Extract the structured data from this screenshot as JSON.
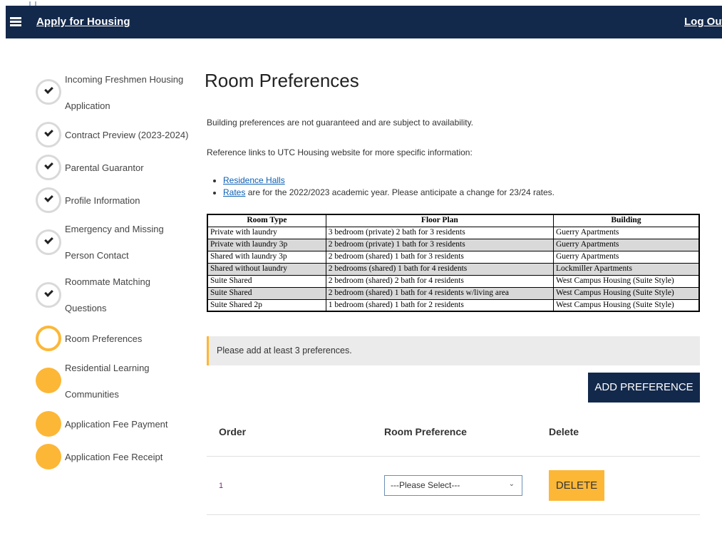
{
  "header": {
    "title": "Apply for Housing",
    "logout": "Log Out"
  },
  "steps": [
    {
      "label_lines": [
        "Incoming Freshmen Housing",
        "Application"
      ],
      "status": "done"
    },
    {
      "label_lines": [
        "Contract Preview (2023-2024)"
      ],
      "status": "done"
    },
    {
      "label_lines": [
        "Parental Guarantor"
      ],
      "status": "done"
    },
    {
      "label_lines": [
        "Profile Information"
      ],
      "status": "done"
    },
    {
      "label_lines": [
        "Emergency and Missing",
        "Person Contact"
      ],
      "status": "done"
    },
    {
      "label_lines": [
        "Roommate Matching",
        "Questions"
      ],
      "status": "done"
    },
    {
      "label_lines": [
        "Room Preferences"
      ],
      "status": "current"
    },
    {
      "label_lines": [
        "Residential Learning",
        "Communities"
      ],
      "status": "todo"
    },
    {
      "label_lines": [
        "Application Fee Payment"
      ],
      "status": "todo"
    },
    {
      "label_lines": [
        "Application Fee Receipt"
      ],
      "status": "todo"
    }
  ],
  "main": {
    "title": "Room Preferences",
    "notice": "Building preferences are not guaranteed and are subject to availability.",
    "reference": "Reference links to UTC Housing website for more specific information:",
    "links": {
      "residence_halls": "Residence Halls",
      "rates_link": "Rates",
      "rates_text": " are for the 2022/2023 academic year. Please anticipate a change for 23/24 rates."
    },
    "table": {
      "headers": [
        "Room Type",
        "Floor Plan",
        "Building"
      ],
      "rows": [
        [
          "Private with laundry",
          "3 bedroom (private) 2 bath for 3 residents",
          "Guerry Apartments"
        ],
        [
          "Private with laundry 3p",
          "2 bedroom (private) 1 bath for 3 residents",
          "Guerry Apartments"
        ],
        [
          "Shared with laundry 3p",
          "2 bedroom (shared) 1 bath for 3 residents",
          "Guerry Apartments"
        ],
        [
          "Shared without laundry",
          "2 bedrooms (shared) 1 bath for 4 residents",
          "Lockmiller Apartments"
        ],
        [
          "Suite Shared",
          "2 bedroom (shared) 2 bath for 4 residents",
          "West Campus Housing (Suite Style)"
        ],
        [
          "Suite Shared",
          "2 bedroom (shared) 1 bath for 4 residents w/living area",
          "West Campus Housing (Suite Style)"
        ],
        [
          "Suite Shared 2p",
          "1 bedroom (shared) 1 bath for 2 residents",
          "West Campus Housing (Suite Style)"
        ]
      ]
    },
    "alert": "Please add at least 3 preferences.",
    "add_button": "ADD PREFERENCE",
    "columns": {
      "order": "Order",
      "preference": "Room Preference",
      "delete": "Delete"
    },
    "pref_row": {
      "order": "1",
      "select_value": "---Please Select---",
      "delete_label": "DELETE"
    }
  },
  "colors": {
    "navy": "#13294b",
    "gold": "#fdb736",
    "link": "#0b5fb4"
  }
}
